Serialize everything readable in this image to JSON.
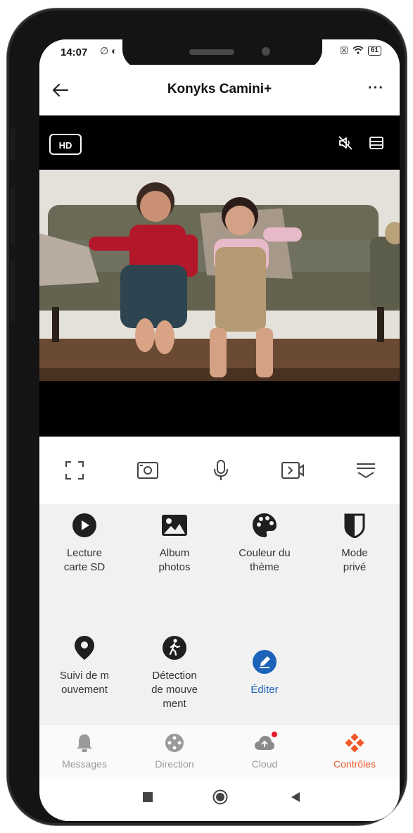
{
  "status_bar": {
    "time": "14:07",
    "battery": "61"
  },
  "header": {
    "title": "Konyks Camini+",
    "more": "···"
  },
  "video": {
    "quality_label": "HD"
  },
  "toolbar": {
    "items": [
      "fullscreen-icon",
      "screenshot-icon",
      "microphone-icon",
      "record-icon",
      "expand-menu-icon"
    ]
  },
  "features": [
    {
      "label": "Lecture\ncarte SD",
      "icon": "play-circle-icon"
    },
    {
      "label": "Album\nphotos",
      "icon": "photo-icon"
    },
    {
      "label": "Couleur du\nthème",
      "icon": "palette-icon"
    },
    {
      "label": "Mode\nprivé",
      "icon": "shield-icon"
    },
    {
      "label": "Suivi de m\nouvement",
      "icon": "location-pin-icon"
    },
    {
      "label": "Détection\nde mouve\nment",
      "icon": "walking-person-icon"
    },
    {
      "label": "Éditer",
      "icon": "edit-pencil-icon"
    }
  ],
  "bottom_nav": [
    {
      "label": "Messages",
      "icon": "bell-icon",
      "active": false
    },
    {
      "label": "Direction",
      "icon": "dpad-icon",
      "active": false
    },
    {
      "label": "Cloud",
      "icon": "cloud-upload-icon",
      "active": false,
      "badge": true
    },
    {
      "label": "Contrôles",
      "icon": "controls-icon",
      "active": true
    }
  ],
  "colors": {
    "accent": "#f05a2a",
    "edit": "#1b63b8",
    "badge": "#e4172b"
  }
}
